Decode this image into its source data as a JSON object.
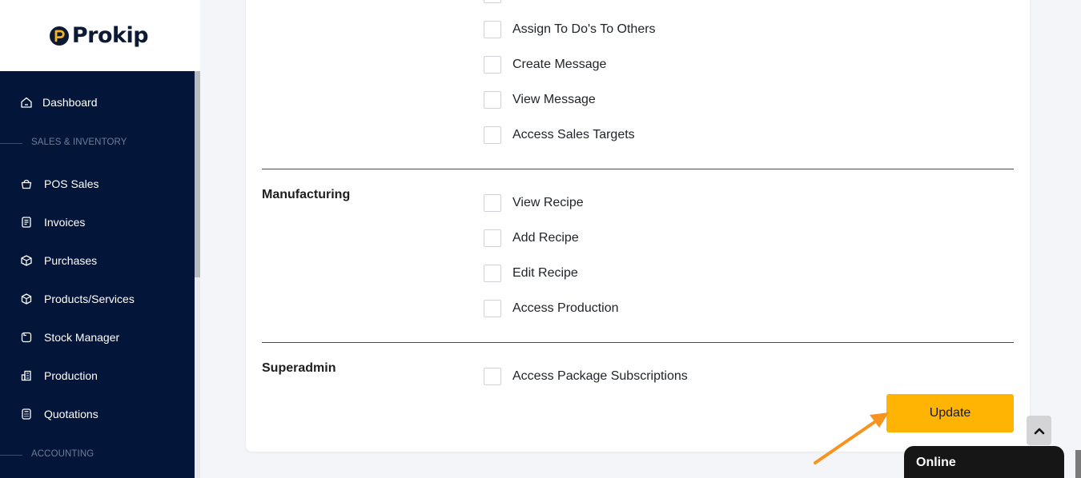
{
  "brand": {
    "name": "Prokip"
  },
  "sidebar": {
    "items": [
      {
        "label": "Dashboard",
        "icon": "home-icon"
      },
      {
        "label": "POS Sales",
        "icon": "basket-icon"
      },
      {
        "label": "Invoices",
        "icon": "invoice-icon"
      },
      {
        "label": "Purchases",
        "icon": "purchase-box-icon"
      },
      {
        "label": "Products/Services",
        "icon": "cube-icon"
      },
      {
        "label": "Stock Manager",
        "icon": "stock-icon"
      },
      {
        "label": "Production",
        "icon": "building-icon"
      },
      {
        "label": "Quotations",
        "icon": "calculator-icon"
      }
    ],
    "sections": {
      "sales_inventory": "SALES & INVENTORY",
      "accounting": "ACCOUNTING"
    }
  },
  "permissions": {
    "top_group": [
      {
        "label": "Assign To Do's To Others",
        "checked": false
      },
      {
        "label": "Create Message",
        "checked": false
      },
      {
        "label": "View Message",
        "checked": false
      },
      {
        "label": "Access Sales Targets",
        "checked": false
      }
    ],
    "manufacturing": {
      "title": "Manufacturing",
      "items": [
        {
          "label": "View Recipe",
          "checked": false
        },
        {
          "label": "Add Recipe",
          "checked": false
        },
        {
          "label": "Edit Recipe",
          "checked": false
        },
        {
          "label": "Access Production",
          "checked": false
        }
      ]
    },
    "superadmin": {
      "title": "Superadmin",
      "items": [
        {
          "label": "Access Package Subscriptions",
          "checked": false
        }
      ]
    }
  },
  "actions": {
    "update_label": "Update"
  },
  "chat": {
    "status_label": "Online"
  },
  "colors": {
    "sidebar_bg": "#03163a",
    "accent": "#ffb302",
    "arrow": "#f7931e",
    "logo_gold": "#f6b31c"
  }
}
